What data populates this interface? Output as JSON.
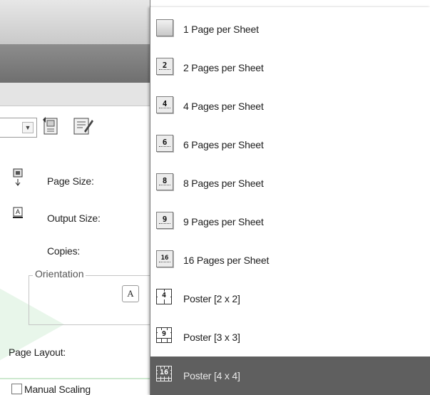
{
  "dialog": {
    "labels": {
      "page_size": "Page Size:",
      "output_size": "Output Size:",
      "copies": "Copies:",
      "orientation": "Orientation",
      "orientation_button": "A",
      "page_layout": "Page Layout:",
      "manual_scaling": "Manual Scaling"
    },
    "icons": {
      "combo_arrow": "chevron-down-icon",
      "tool_button_1": "page-setup-icon",
      "tool_button_2": "page-edit-icon"
    },
    "manual_scaling_checked": false
  },
  "layout_menu": {
    "items": [
      {
        "label": "1 Page per Sheet",
        "icon": "one-page-icon",
        "badge": ""
      },
      {
        "label": "2 Pages per Sheet",
        "icon": "two-pages-icon",
        "badge": "2"
      },
      {
        "label": "4 Pages per Sheet",
        "icon": "four-pages-icon",
        "badge": "4"
      },
      {
        "label": "6 Pages per Sheet",
        "icon": "six-pages-icon",
        "badge": "6"
      },
      {
        "label": "8 Pages per Sheet",
        "icon": "eight-pages-icon",
        "badge": "8"
      },
      {
        "label": "9 Pages per Sheet",
        "icon": "nine-pages-icon",
        "badge": "9"
      },
      {
        "label": "16 Pages per Sheet",
        "icon": "sixteen-pages-icon",
        "badge": "16"
      },
      {
        "label": "Poster [2 x 2]",
        "icon": "poster-2x2-icon",
        "badge": "4"
      },
      {
        "label": "Poster [3 x 3]",
        "icon": "poster-3x3-icon",
        "badge": "9"
      },
      {
        "label": "Poster [4 x 4]",
        "icon": "poster-4x4-icon",
        "badge": "16"
      }
    ],
    "selected_label": "Poster [4 x 4]"
  },
  "colors": {
    "selected_bg": "#5f5f5f",
    "selected_text": "#e9e9e9"
  }
}
